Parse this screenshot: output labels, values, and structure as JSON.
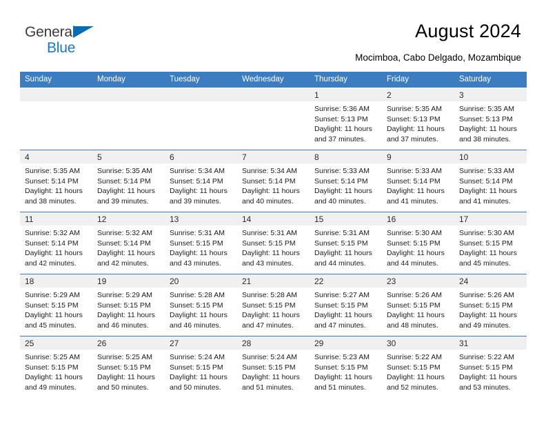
{
  "brand": {
    "name_part1": "General",
    "name_part2": "Blue",
    "triangle_color": "#0a6cb5",
    "text_color": "#3a3a3a",
    "accent_color": "#1878c4"
  },
  "header": {
    "title": "August 2024",
    "subtitle": "Mocimboa, Cabo Delgado, Mozambique"
  },
  "theme": {
    "header_band": "#3b7dc0",
    "daynum_band": "#f0f0f0",
    "row_rule": "#3b7dc0"
  },
  "weekdays": [
    "Sunday",
    "Monday",
    "Tuesday",
    "Wednesday",
    "Thursday",
    "Friday",
    "Saturday"
  ],
  "labels": {
    "sunrise_prefix": "Sunrise:",
    "sunset_prefix": "Sunset:",
    "daylight_prefix": "Daylight:"
  },
  "weeks": [
    [
      {
        "day": "",
        "blank": true
      },
      {
        "day": "",
        "blank": true
      },
      {
        "day": "",
        "blank": true
      },
      {
        "day": "",
        "blank": true
      },
      {
        "day": "1",
        "sunrise": "Sunrise: 5:36 AM",
        "sunset": "Sunset: 5:13 PM",
        "daylight": "Daylight: 11 hours and 37 minutes."
      },
      {
        "day": "2",
        "sunrise": "Sunrise: 5:35 AM",
        "sunset": "Sunset: 5:13 PM",
        "daylight": "Daylight: 11 hours and 37 minutes."
      },
      {
        "day": "3",
        "sunrise": "Sunrise: 5:35 AM",
        "sunset": "Sunset: 5:13 PM",
        "daylight": "Daylight: 11 hours and 38 minutes."
      }
    ],
    [
      {
        "day": "4",
        "sunrise": "Sunrise: 5:35 AM",
        "sunset": "Sunset: 5:14 PM",
        "daylight": "Daylight: 11 hours and 38 minutes."
      },
      {
        "day": "5",
        "sunrise": "Sunrise: 5:35 AM",
        "sunset": "Sunset: 5:14 PM",
        "daylight": "Daylight: 11 hours and 39 minutes."
      },
      {
        "day": "6",
        "sunrise": "Sunrise: 5:34 AM",
        "sunset": "Sunset: 5:14 PM",
        "daylight": "Daylight: 11 hours and 39 minutes."
      },
      {
        "day": "7",
        "sunrise": "Sunrise: 5:34 AM",
        "sunset": "Sunset: 5:14 PM",
        "daylight": "Daylight: 11 hours and 40 minutes."
      },
      {
        "day": "8",
        "sunrise": "Sunrise: 5:33 AM",
        "sunset": "Sunset: 5:14 PM",
        "daylight": "Daylight: 11 hours and 40 minutes."
      },
      {
        "day": "9",
        "sunrise": "Sunrise: 5:33 AM",
        "sunset": "Sunset: 5:14 PM",
        "daylight": "Daylight: 11 hours and 41 minutes."
      },
      {
        "day": "10",
        "sunrise": "Sunrise: 5:33 AM",
        "sunset": "Sunset: 5:14 PM",
        "daylight": "Daylight: 11 hours and 41 minutes."
      }
    ],
    [
      {
        "day": "11",
        "sunrise": "Sunrise: 5:32 AM",
        "sunset": "Sunset: 5:14 PM",
        "daylight": "Daylight: 11 hours and 42 minutes."
      },
      {
        "day": "12",
        "sunrise": "Sunrise: 5:32 AM",
        "sunset": "Sunset: 5:14 PM",
        "daylight": "Daylight: 11 hours and 42 minutes."
      },
      {
        "day": "13",
        "sunrise": "Sunrise: 5:31 AM",
        "sunset": "Sunset: 5:15 PM",
        "daylight": "Daylight: 11 hours and 43 minutes."
      },
      {
        "day": "14",
        "sunrise": "Sunrise: 5:31 AM",
        "sunset": "Sunset: 5:15 PM",
        "daylight": "Daylight: 11 hours and 43 minutes."
      },
      {
        "day": "15",
        "sunrise": "Sunrise: 5:31 AM",
        "sunset": "Sunset: 5:15 PM",
        "daylight": "Daylight: 11 hours and 44 minutes."
      },
      {
        "day": "16",
        "sunrise": "Sunrise: 5:30 AM",
        "sunset": "Sunset: 5:15 PM",
        "daylight": "Daylight: 11 hours and 44 minutes."
      },
      {
        "day": "17",
        "sunrise": "Sunrise: 5:30 AM",
        "sunset": "Sunset: 5:15 PM",
        "daylight": "Daylight: 11 hours and 45 minutes."
      }
    ],
    [
      {
        "day": "18",
        "sunrise": "Sunrise: 5:29 AM",
        "sunset": "Sunset: 5:15 PM",
        "daylight": "Daylight: 11 hours and 45 minutes."
      },
      {
        "day": "19",
        "sunrise": "Sunrise: 5:29 AM",
        "sunset": "Sunset: 5:15 PM",
        "daylight": "Daylight: 11 hours and 46 minutes."
      },
      {
        "day": "20",
        "sunrise": "Sunrise: 5:28 AM",
        "sunset": "Sunset: 5:15 PM",
        "daylight": "Daylight: 11 hours and 46 minutes."
      },
      {
        "day": "21",
        "sunrise": "Sunrise: 5:28 AM",
        "sunset": "Sunset: 5:15 PM",
        "daylight": "Daylight: 11 hours and 47 minutes."
      },
      {
        "day": "22",
        "sunrise": "Sunrise: 5:27 AM",
        "sunset": "Sunset: 5:15 PM",
        "daylight": "Daylight: 11 hours and 47 minutes."
      },
      {
        "day": "23",
        "sunrise": "Sunrise: 5:26 AM",
        "sunset": "Sunset: 5:15 PM",
        "daylight": "Daylight: 11 hours and 48 minutes."
      },
      {
        "day": "24",
        "sunrise": "Sunrise: 5:26 AM",
        "sunset": "Sunset: 5:15 PM",
        "daylight": "Daylight: 11 hours and 49 minutes."
      }
    ],
    [
      {
        "day": "25",
        "sunrise": "Sunrise: 5:25 AM",
        "sunset": "Sunset: 5:15 PM",
        "daylight": "Daylight: 11 hours and 49 minutes."
      },
      {
        "day": "26",
        "sunrise": "Sunrise: 5:25 AM",
        "sunset": "Sunset: 5:15 PM",
        "daylight": "Daylight: 11 hours and 50 minutes."
      },
      {
        "day": "27",
        "sunrise": "Sunrise: 5:24 AM",
        "sunset": "Sunset: 5:15 PM",
        "daylight": "Daylight: 11 hours and 50 minutes."
      },
      {
        "day": "28",
        "sunrise": "Sunrise: 5:24 AM",
        "sunset": "Sunset: 5:15 PM",
        "daylight": "Daylight: 11 hours and 51 minutes."
      },
      {
        "day": "29",
        "sunrise": "Sunrise: 5:23 AM",
        "sunset": "Sunset: 5:15 PM",
        "daylight": "Daylight: 11 hours and 51 minutes."
      },
      {
        "day": "30",
        "sunrise": "Sunrise: 5:22 AM",
        "sunset": "Sunset: 5:15 PM",
        "daylight": "Daylight: 11 hours and 52 minutes."
      },
      {
        "day": "31",
        "sunrise": "Sunrise: 5:22 AM",
        "sunset": "Sunset: 5:15 PM",
        "daylight": "Daylight: 11 hours and 53 minutes."
      }
    ]
  ]
}
